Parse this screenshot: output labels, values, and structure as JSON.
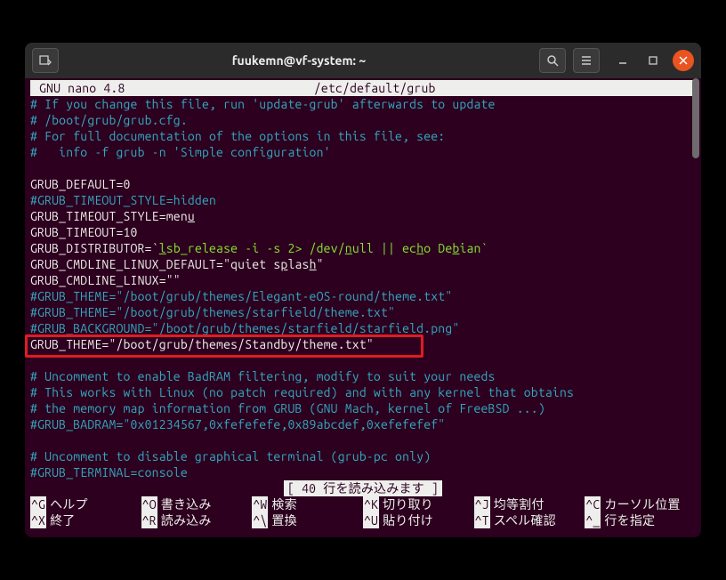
{
  "titlebar": {
    "title": "fuukemn@vf-system: ~"
  },
  "editor": {
    "app": "GNU nano 4.8",
    "filepath": "/etc/default/grub"
  },
  "content": {
    "c1": "# If you change this file, run 'update-grub' afterwards to update",
    "c2": "# /boot/grub/grub.cfg.",
    "c3": "# For full documentation of the options in this file, see:",
    "c4": "#   info -f grub -n 'Simple configuration'",
    "l_default": "GRUB_DEFAULT=0",
    "c_timeout_style": "#GRUB_TIMEOUT_STYLE=hidden",
    "l_timeout_style_pre": "GRUB_TIMEOUT_STYLE=men",
    "l_timeout_style_u": "u",
    "l_timeout": "GRUB_TIMEOUT=10",
    "l_dist_pre": "GRUB_DISTRIBUTOR=`",
    "l_dist_lsb": "l",
    "l_dist_mid1": "sb_release -i -s 2> /dev/",
    "l_dist_null_n": "n",
    "l_dist_mid2": "ull || ec",
    "l_dist_echo_h": "h",
    "l_dist_mid3": "o De",
    "l_dist_b": "b",
    "l_dist_mid4": "ian`",
    "l_cmd_default_pre": "GRUB_CMDLINE_LINUX_DEFAULT=\"quiet s",
    "l_cmd_default_p": "p",
    "l_cmd_default_mid": "las",
    "l_cmd_default_h": "h",
    "l_cmd_default_end": "\"",
    "l_cmd_linux": "GRUB_CMDLINE_LINUX=\"\"",
    "c_theme1": "#GRUB_THEME=\"/boot/grub/themes/Elegant-eOS-round/theme.txt\"",
    "c_theme2": "#GRUB_THEME=\"/boot/grub/themes/starfield/theme.txt\"",
    "c_bg": "#GRUB_BACKGROUND=\"/boot/grub/themes/starfield/starfield.png\"",
    "l_theme_active": "GRUB_THEME=\"/boot/grub/themes/Standby/theme.txt\"",
    "c_badram1": "# Uncomment to enable BadRAM filtering, modify to suit your needs",
    "c_badram2": "# This works with Linux (no patch required) and with any kernel that obtains",
    "c_badram3": "# the memory map information from GRUB (GNU Mach, kernel of FreeBSD ...)",
    "c_badram4": "#GRUB_BADRAM=\"0x01234567,0xfefefefe,0x89abcdef,0xefefefef\"",
    "c_term1": "# Uncomment to disable graphical terminal (grub-pc only)",
    "c_term2": "#GRUB_TERMINAL=console"
  },
  "status": "[ 40 行を読み込みます ]",
  "shortcuts": {
    "r1": [
      {
        "key": "^G",
        "label": "ヘルプ"
      },
      {
        "key": "^O",
        "label": "書き込み"
      },
      {
        "key": "^W",
        "label": "検索"
      },
      {
        "key": "^K",
        "label": "切り取り"
      },
      {
        "key": "^J",
        "label": "均等割付"
      },
      {
        "key": "^C",
        "label": "カーソル位置"
      }
    ],
    "r2": [
      {
        "key": "^X",
        "label": "終了"
      },
      {
        "key": "^R",
        "label": "読み込み"
      },
      {
        "key": "^\\",
        "label": "置換"
      },
      {
        "key": "^U",
        "label": "貼り付け"
      },
      {
        "key": "^T",
        "label": "スペル確認"
      },
      {
        "key": "^_",
        "label": "行を指定"
      }
    ]
  },
  "icons": {
    "newtab": "new-tab-icon",
    "search": "search-icon",
    "menu": "hamburger-icon",
    "min": "minimize-icon",
    "max": "maximize-icon",
    "close": "close-icon"
  }
}
